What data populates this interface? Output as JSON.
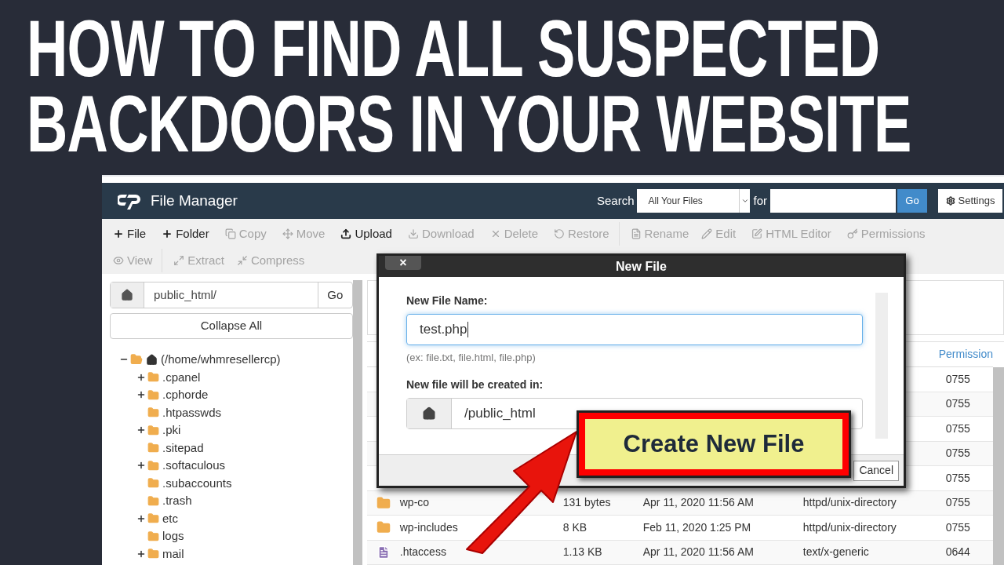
{
  "headline": [
    "HOW TO FIND ALL SUSPECTED",
    "BACKDOORS IN YOUR WEBSITE"
  ],
  "app": {
    "title": "File Manager",
    "search_label": "Search",
    "search_scope": "All Your Files",
    "for_label": "for",
    "go": "Go",
    "settings": "Settings"
  },
  "toolbar": [
    [
      {
        "label": "File",
        "disabled": false
      },
      {
        "label": "Folder",
        "disabled": false
      },
      {
        "label": "Copy",
        "disabled": true
      },
      {
        "label": "Move",
        "disabled": true
      },
      {
        "label": "Upload",
        "disabled": false
      },
      {
        "label": "Download",
        "disabled": true
      },
      {
        "label": "Delete",
        "disabled": true
      },
      {
        "label": "Restore",
        "disabled": true
      },
      {
        "label": "Rename",
        "disabled": true
      },
      {
        "label": "Edit",
        "disabled": true
      },
      {
        "label": "HTML Editor",
        "disabled": true
      },
      {
        "label": "Permissions",
        "disabled": true
      }
    ],
    [
      {
        "label": "View",
        "disabled": true
      },
      {
        "label": "Extract",
        "disabled": true
      },
      {
        "label": "Compress",
        "disabled": true
      }
    ]
  ],
  "sidebar": {
    "path": "public_html/",
    "go": "Go",
    "collapse": "Collapse All",
    "tree": [
      {
        "label": "(/home/whmresellercp)",
        "expandable": true,
        "expanded": true,
        "children": [
          {
            "label": ".cpanel",
            "expandable": true,
            "expanded": false
          },
          {
            "label": ".cphorde",
            "expandable": true,
            "expanded": false
          },
          {
            "label": ".htpasswds",
            "expandable": false,
            "expanded": false
          },
          {
            "label": ".pki",
            "expandable": true,
            "expanded": false
          },
          {
            "label": ".sitepad",
            "expandable": false,
            "expanded": false
          },
          {
            "label": ".softaculous",
            "expandable": true,
            "expanded": false
          },
          {
            "label": ".subaccounts",
            "expandable": false,
            "expanded": false
          },
          {
            "label": ".trash",
            "expandable": false,
            "expanded": false
          },
          {
            "label": "etc",
            "expandable": true,
            "expanded": false
          },
          {
            "label": "logs",
            "expandable": false,
            "expanded": false
          },
          {
            "label": "mail",
            "expandable": true,
            "expanded": false
          }
        ]
      }
    ]
  },
  "table": {
    "columns": [
      "Permission"
    ],
    "rows": [
      {
        "permissions": "0755"
      },
      {
        "permissions": "0755"
      },
      {
        "permissions": "0755"
      },
      {
        "permissions": "0755"
      },
      {
        "permissions": "0755"
      },
      {
        "kind": "folder",
        "name": "wp-co",
        "size": "131 bytes",
        "modified": "Apr 11, 2020 11:56 AM",
        "type": "httpd/unix-directory",
        "permissions": "0755"
      },
      {
        "kind": "folder",
        "name": "wp-includes",
        "size": "8 KB",
        "modified": "Feb 11, 2020 1:25 PM",
        "type": "httpd/unix-directory",
        "permissions": "0755"
      },
      {
        "kind": "file",
        "name": ".htaccess",
        "size": "1.13 KB",
        "modified": "Apr 11, 2020 11:56 AM",
        "type": "text/x-generic",
        "permissions": "0644"
      }
    ]
  },
  "dialog": {
    "title": "New File",
    "close": "×",
    "name_label": "New File Name:",
    "name_value": "test.php",
    "hint": "(ex: file.txt, file.html, file.php)",
    "dir_label": "New file will be created in:",
    "dir_value": "/public_html",
    "create": "Create New File",
    "cancel": "Cancel"
  }
}
